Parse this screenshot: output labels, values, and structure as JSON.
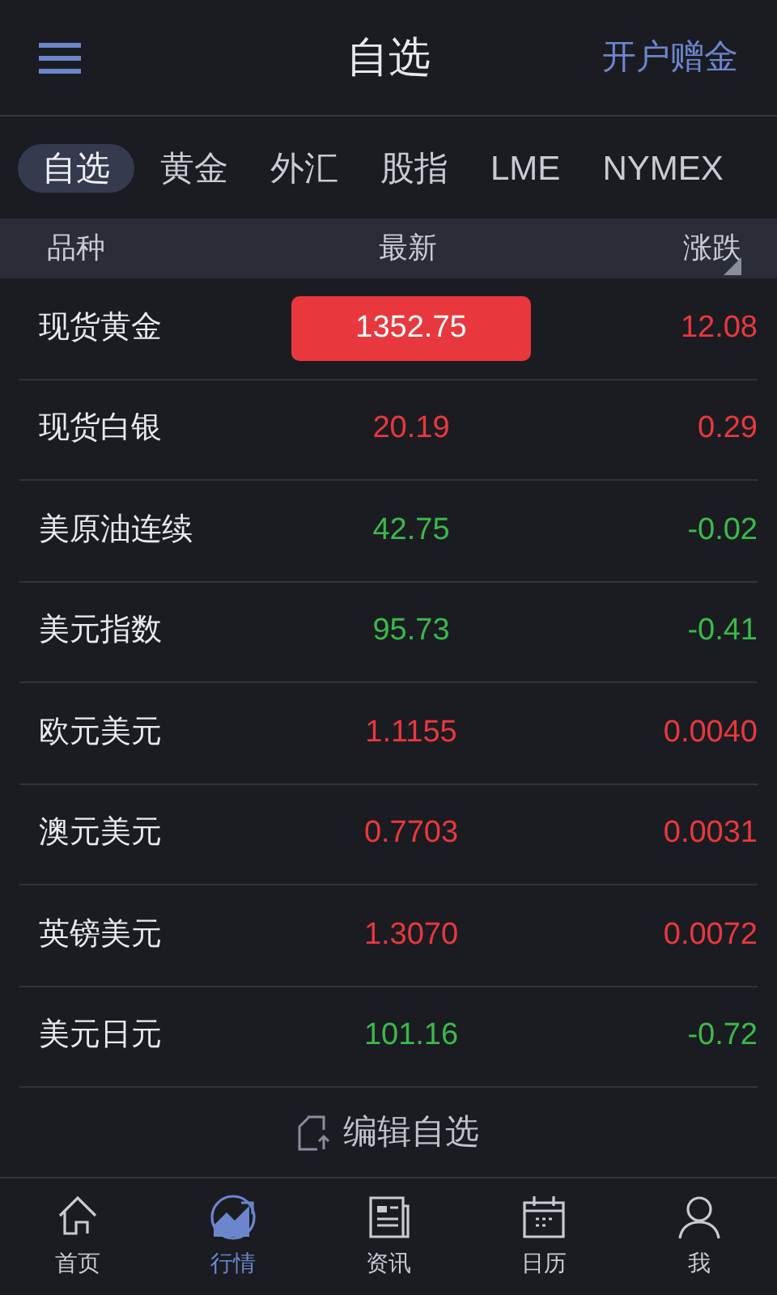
{
  "header": {
    "title": "自选",
    "action": "开户赠金"
  },
  "tabs": [
    {
      "label": "自选",
      "selected": true
    },
    {
      "label": "黄金",
      "selected": false
    },
    {
      "label": "外汇",
      "selected": false
    },
    {
      "label": "股指",
      "selected": false
    },
    {
      "label": "LME",
      "selected": false
    },
    {
      "label": "NYMEX",
      "selected": false
    }
  ],
  "table": {
    "columns": [
      "品种",
      "最新",
      "涨跌"
    ],
    "rows": [
      {
        "name": "现货黄金",
        "price": "1352.75",
        "change": "12.08",
        "color": "#e8383d",
        "highlighted": true
      },
      {
        "name": "现货白银",
        "price": "20.19",
        "change": "0.29",
        "color": "#e8383d",
        "highlighted": false
      },
      {
        "name": "美原油连续",
        "price": "42.75",
        "change": "-0.02",
        "color": "#3cb84a",
        "highlighted": false
      },
      {
        "name": "美元指数",
        "price": "95.73",
        "change": "-0.41",
        "color": "#3cb84a",
        "highlighted": false
      },
      {
        "name": "欧元美元",
        "price": "1.1155",
        "change": "0.0040",
        "color": "#e8383d",
        "highlighted": false
      },
      {
        "name": "澳元美元",
        "price": "0.7703",
        "change": "0.0031",
        "color": "#e8383d",
        "highlighted": false
      },
      {
        "name": "英镑美元",
        "price": "1.3070",
        "change": "0.0072",
        "color": "#e8383d",
        "highlighted": false
      },
      {
        "name": "美元日元",
        "price": "101.16",
        "change": "-0.72",
        "color": "#3cb84a",
        "highlighted": false
      }
    ]
  },
  "edit_button": "编辑自选",
  "bottom_nav": [
    {
      "label": "首页",
      "kind": "home",
      "selected": false
    },
    {
      "label": "行情",
      "kind": "market",
      "selected": true
    },
    {
      "label": "资讯",
      "kind": "news",
      "selected": false
    },
    {
      "label": "日历",
      "kind": "calendar",
      "selected": false
    },
    {
      "label": "我",
      "kind": "profile",
      "selected": false
    }
  ]
}
